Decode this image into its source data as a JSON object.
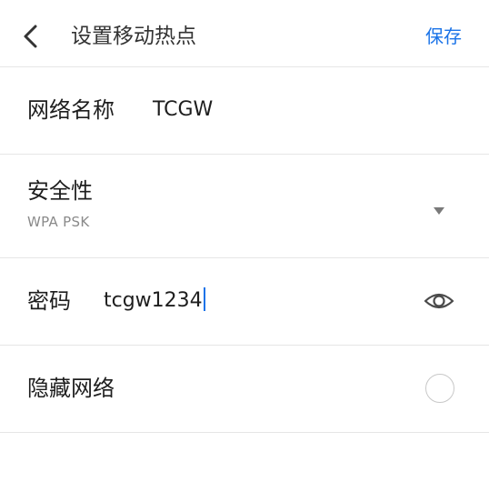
{
  "header": {
    "title": "设置移动热点",
    "save_label": "保存",
    "back_icon": "chevron-left-icon"
  },
  "fields": {
    "network_name": {
      "label": "网络名称",
      "value": "TCGW"
    },
    "security": {
      "label": "安全性",
      "value": "WPA PSK",
      "icon": "dropdown-triangle-icon"
    },
    "password": {
      "label": "密码",
      "value": "tcgw1234",
      "icon": "eye-icon"
    },
    "hidden_network": {
      "label": "隐藏网络",
      "checked": false
    }
  },
  "colors": {
    "accent": "#1a73e8",
    "divider": "#e6e6e6",
    "secondary_text": "#8a8a8a"
  }
}
